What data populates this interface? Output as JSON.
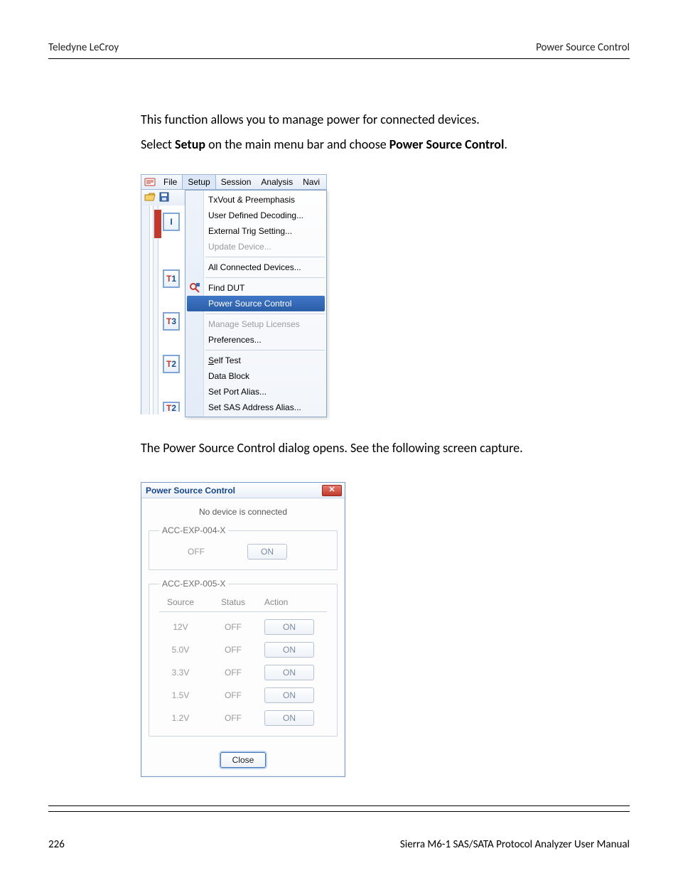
{
  "header": {
    "left": "Teledyne LeCroy",
    "right": "Power Source Control"
  },
  "para1": "This function allows you to manage power for connected devices.",
  "para2a": "Select ",
  "para2b": "Setup",
  "para2c": " on the main menu bar and choose ",
  "para2d": "Power Source Control",
  "para2e": ".",
  "menu": {
    "file": "File",
    "setup": "Setup",
    "session": "Session",
    "analysis": "Analysis",
    "navi": "Navi",
    "items": {
      "txvout": "TxVout & Preemphasis",
      "udd": "User Defined Decoding...",
      "ext": "External Trig Setting...",
      "update": "Update Device...",
      "allconn": "All Connected Devices...",
      "finddut": "Find DUT",
      "psc": "Power Source Control",
      "licenses": "Manage Setup Licenses",
      "prefs": "Preferences...",
      "selftest": "Self Test",
      "datablock": "Data Block",
      "portalias": "Set Port Alias...",
      "sasalias": "Set SAS Address Alias..."
    },
    "tags": {
      "t1": "T1",
      "t3": "T3",
      "t2a": "T2",
      "t2b": "T2",
      "i": "I"
    }
  },
  "para3": "The Power Source Control dialog opens. See the following screen capture.",
  "dialog": {
    "title": "Power Source Control",
    "status": "No device is connected",
    "group1": {
      "legend": "ACC-EXP-004-X",
      "off": "OFF",
      "on": "ON"
    },
    "group2": {
      "legend": "ACC-EXP-005-X",
      "hdr_source": "Source",
      "hdr_status": "Status",
      "hdr_action": "Action",
      "rows": [
        {
          "source": "12V",
          "status": "OFF",
          "action": "ON"
        },
        {
          "source": "5.0V",
          "status": "OFF",
          "action": "ON"
        },
        {
          "source": "3.3V",
          "status": "OFF",
          "action": "ON"
        },
        {
          "source": "1.5V",
          "status": "OFF",
          "action": "ON"
        },
        {
          "source": "1.2V",
          "status": "OFF",
          "action": "ON"
        }
      ]
    },
    "close": "Close",
    "x": "x"
  },
  "footer": {
    "page": "226",
    "title": "Sierra M6-1 SAS/SATA Protocol Analyzer User Manual"
  }
}
